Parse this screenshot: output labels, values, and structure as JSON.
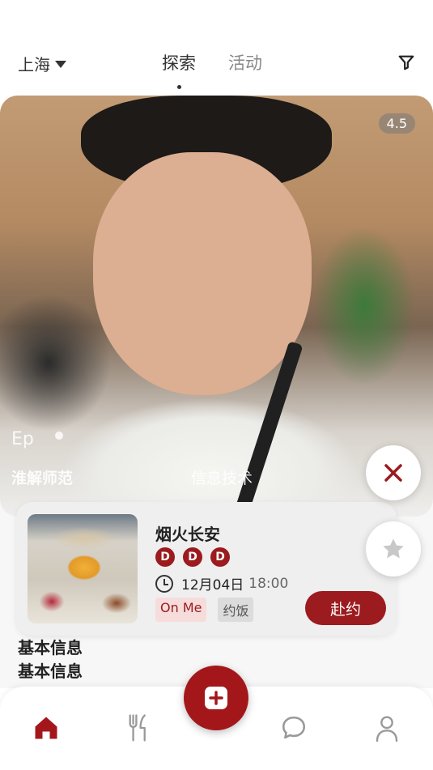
{
  "header": {
    "city": "上海",
    "tabs": [
      {
        "label": "探索",
        "active": true
      },
      {
        "label": "活动",
        "active": false
      }
    ]
  },
  "profile": {
    "rating": "4.5",
    "overlay_name": "Ep",
    "overlay_line_1": "淮解师范",
    "overlay_line_2": "信息技术"
  },
  "info_section": {
    "heading_1": "基本信息",
    "heading_2": "基本信息"
  },
  "event": {
    "title": "烟火长安",
    "badges": [
      "D",
      "D",
      "D"
    ],
    "date": "12月04日",
    "time": "18:00",
    "tags": [
      "On Me",
      "约饭"
    ],
    "join_label": "赴约"
  },
  "colors": {
    "brand": "#9b1b1e",
    "fab": "#a3171b"
  },
  "icons": {
    "filter": "filter-icon",
    "close": "close-icon",
    "star": "star-icon",
    "home": "home-icon",
    "dining": "dining-icon",
    "add": "add-icon",
    "chat": "chat-icon",
    "profile": "profile-icon"
  }
}
